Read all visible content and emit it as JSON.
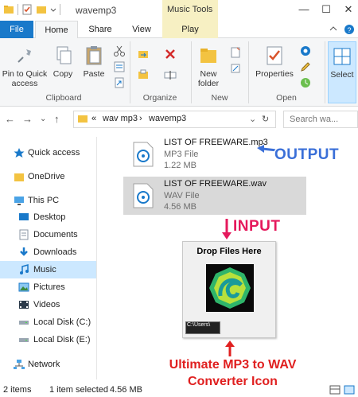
{
  "window": {
    "title": "wavemp3",
    "contextual_group": "Music Tools"
  },
  "tabs": {
    "file": "File",
    "home": "Home",
    "share": "Share",
    "view": "View",
    "play": "Play"
  },
  "ribbon": {
    "pin_label_1": "Pin to Quick",
    "pin_label_2": "access",
    "copy": "Copy",
    "paste": "Paste",
    "clipboard_group": "Clipboard",
    "organize_group": "Organize",
    "new_folder_1": "New",
    "new_folder_2": "folder",
    "new_group": "New",
    "properties": "Properties",
    "open_group": "Open",
    "select": "Select"
  },
  "address": {
    "chevrons": "«",
    "crumb_1": "wav mp3",
    "crumb_sep": "›",
    "crumb_2": "wavemp3",
    "search_placeholder": "Search wa..."
  },
  "nav": {
    "items": [
      {
        "label": "Quick access",
        "icon": "star-icon"
      },
      {
        "label": "OneDrive",
        "icon": "folder-icon"
      },
      {
        "label": "This PC",
        "icon": "computer-icon"
      },
      {
        "label": "Desktop",
        "icon": "desktop-icon"
      },
      {
        "label": "Documents",
        "icon": "documents-icon"
      },
      {
        "label": "Downloads",
        "icon": "download-icon"
      },
      {
        "label": "Music",
        "icon": "music-icon"
      },
      {
        "label": "Pictures",
        "icon": "pictures-icon"
      },
      {
        "label": "Videos",
        "icon": "videos-icon"
      },
      {
        "label": "Local Disk (C:)",
        "icon": "disk-icon"
      },
      {
        "label": "Local Disk (E:)",
        "icon": "disk-icon"
      },
      {
        "label": "Network",
        "icon": "network-icon"
      }
    ]
  },
  "files": [
    {
      "name": "LIST OF FREEWARE.mp3",
      "type": "MP3 File",
      "size": "1.22 MB"
    },
    {
      "name": "LIST OF FREEWARE.wav",
      "type": "WAV File",
      "size": "4.56 MB"
    }
  ],
  "annotations": {
    "output": "OUTPUT",
    "input": "INPUT",
    "caption_1": "Ultimate MP3 to WAV",
    "caption_2": "Converter Icon"
  },
  "dropbox": {
    "title": "Drop Files Here",
    "path": "C:\\Users\\"
  },
  "status": {
    "items": "2 items",
    "selected": "1 item selected",
    "size": "4.56 MB"
  },
  "colors": {
    "accent": "#1979ca",
    "selection": "#cce8ff",
    "output_annotation": "#3a6fd8",
    "input_annotation": "#e5195c",
    "caption": "#e02020"
  }
}
